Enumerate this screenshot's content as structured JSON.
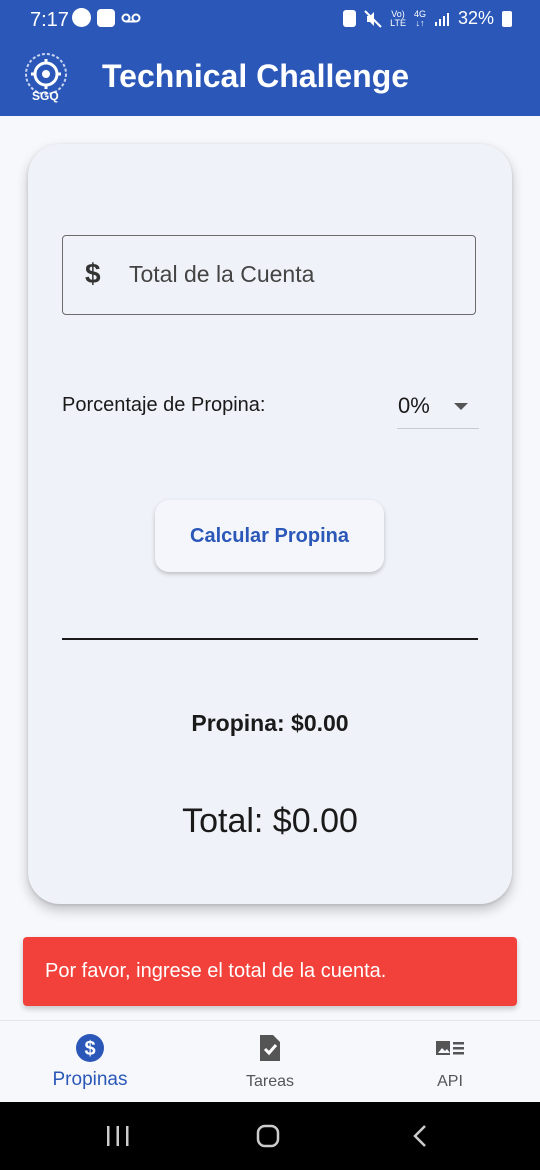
{
  "status_bar": {
    "time": "7:17",
    "network": "4G",
    "network_sub": "LTE",
    "volte": "Vo)",
    "battery": "32%"
  },
  "app_bar": {
    "logo_text": "SGQ",
    "title": "Technical Challenge"
  },
  "form": {
    "currency_symbol": "$",
    "bill_placeholder": "Total de la Cuenta",
    "bill_value": "",
    "percentage_label": "Porcentaje de Propina:",
    "percentage_selected": "0%",
    "calculate_label": "Calcular Propina"
  },
  "results": {
    "tip": "Propina: $0.00",
    "total": "Total: $0.00"
  },
  "snackbar": {
    "message": "Por favor, ingrese el total de la cuenta."
  },
  "bottom_nav": {
    "items": [
      {
        "label": "Propinas",
        "icon": "dollar-circle-icon",
        "active": true
      },
      {
        "label": "Tareas",
        "icon": "task-check-icon",
        "active": false
      },
      {
        "label": "API",
        "icon": "list-image-icon",
        "active": false
      }
    ]
  },
  "colors": {
    "primary": "#2b58b8",
    "error": "#f2413a",
    "card": "#eff2f8"
  }
}
